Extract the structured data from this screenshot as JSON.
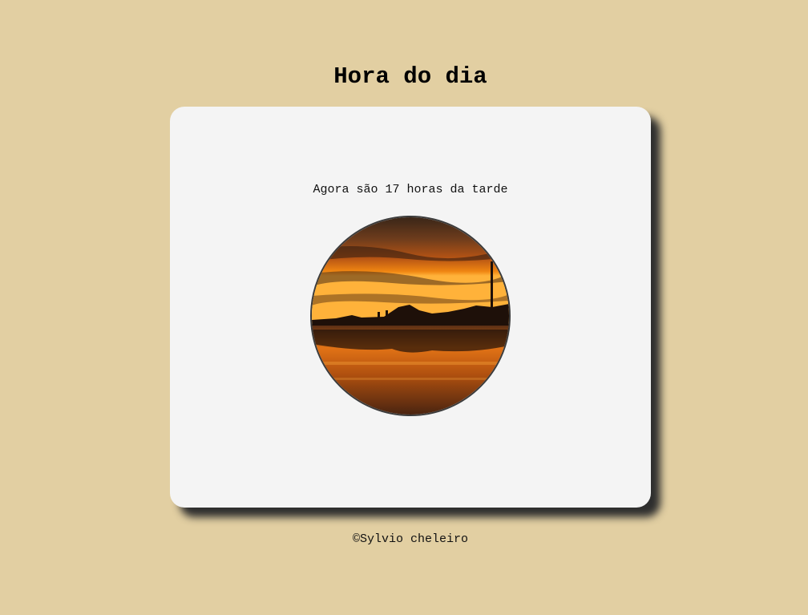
{
  "header": {
    "title": "Hora do dia"
  },
  "card": {
    "message": "Agora são 17 horas da tarde",
    "image": {
      "subject": "sunset-beach-photo",
      "sky_color": "#f07a10",
      "water_color": "#d8640f"
    }
  },
  "footer": {
    "copyright": "©Sylvio cheleiro"
  }
}
